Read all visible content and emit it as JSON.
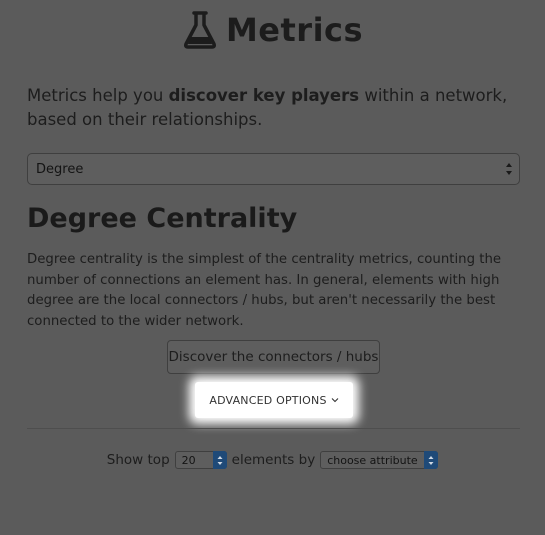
{
  "header": {
    "title": "Metrics",
    "icon": "flask-icon"
  },
  "intro": {
    "before": "Metrics help you ",
    "bold": "discover key players",
    "after": " within a network, based on their relationships."
  },
  "metric_select": {
    "value": "Degree"
  },
  "section": {
    "title": "Degree Centrality",
    "description": "Degree centrality is the simplest of the centrality metrics, counting the number of connections an element has. In general, elements with high degree are the local connectors / hubs, but aren't necessarily the best connected to the wider network."
  },
  "discover_button": {
    "label": "Discover the connectors / hubs"
  },
  "advanced_options": {
    "label": "ADVANCED OPTIONS",
    "chevron": "chevron-down-icon"
  },
  "show_top": {
    "prefix": "Show top",
    "count": "20",
    "middle": "elements by",
    "attribute": "choose attribute"
  },
  "colors": {
    "overlay": "#5b5b5b",
    "highlight": "#ffffff",
    "select_accent": "#1f4a78"
  }
}
